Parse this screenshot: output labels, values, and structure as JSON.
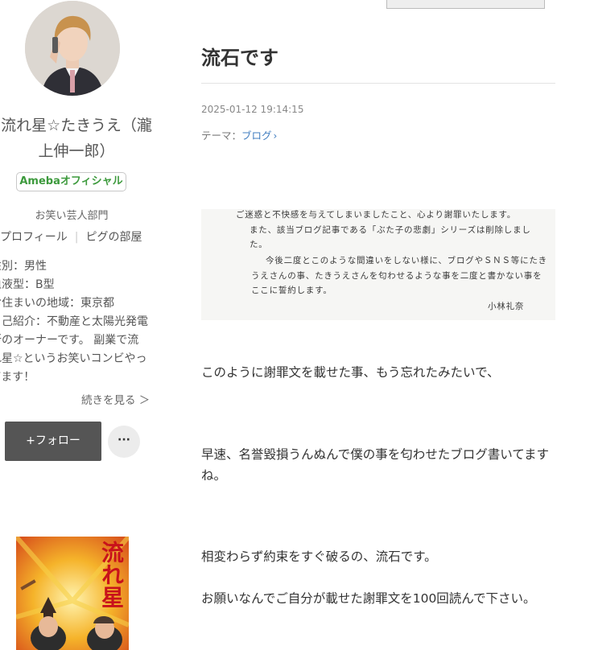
{
  "sidebar": {
    "avatar_icon": "profile-photo",
    "name_lines": [
      "流れ星☆たきうえ（瀧",
      "上伸一郎）"
    ],
    "badge": "Amebaオフィシャル",
    "category": "お笑い芸人部門",
    "links": [
      "プロフィール",
      "ピグの部屋"
    ],
    "profile_lines": [
      "性別：男性",
      "血液型：B型",
      "お住まいの地域：東京都",
      "自己紹介：不動産と太陽光発電",
      "所のオーナーです。 副業で流",
      "れ星☆というお笑いコンビやっ",
      "てます！"
    ],
    "read_more": "続きを見る ＞",
    "follow_label": "+フォロー",
    "more_label": "···",
    "book_title": "流れ星"
  },
  "post": {
    "title": "流石です",
    "date": "2025-01-12 19:14:15",
    "theme_label": "テーマ：",
    "theme_link": "ブログ",
    "theme_chevron": "›",
    "scan_lines": [
      "ご迷惑と不快感を与えてしまいましたこと、心より謝罪いたします。",
      "また、該当ブログ記事である「ぶた子の悲劇」シリーズは削除しまし",
      "た。",
      "今後二度とこのような間違いをしない様に、ブログやＳＮＳ等にたき",
      "うえさんの事、たきうえさんを匂わせるような事を二度と書かない事を",
      "ここに誓約します。",
      "小林礼奈"
    ],
    "paragraphs": [
      "このように謝罪文を載せた事、もう忘れたみたいで、",
      "早速、名誉毀損うんぬんで僕の事を匂わせたブログ書いてますね。",
      "相変わらず約束をすぐ破るの、流石です。",
      "お願いなんでご自分が載せた謝罪文を100回読んで下さい。"
    ]
  },
  "colors": {
    "link": "#3f7cbf",
    "badge_text": "#3d9a3d",
    "follow_bg": "#555555"
  }
}
